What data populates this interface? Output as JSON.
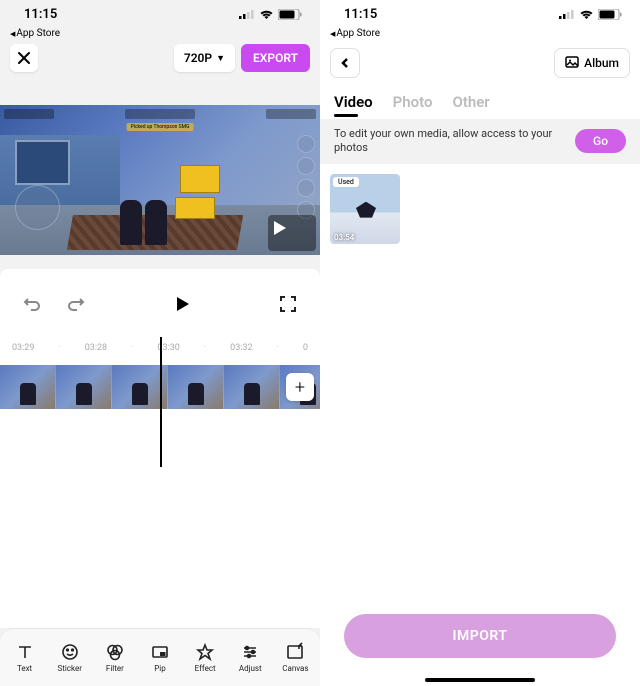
{
  "status": {
    "time": "11:15",
    "back_label": "App Store"
  },
  "left": {
    "resolution": "720P",
    "export": "EXPORT",
    "preview_tag": "Picked up Thompson SMG",
    "timecodes": [
      "03:29",
      "03:28",
      "03:30",
      "03:32"
    ],
    "toolbar": [
      {
        "key": "text",
        "label": "Text"
      },
      {
        "key": "sticker",
        "label": "Sticker"
      },
      {
        "key": "filter",
        "label": "Filter"
      },
      {
        "key": "pip",
        "label": "Pip"
      },
      {
        "key": "effect",
        "label": "Effect"
      },
      {
        "key": "adjust",
        "label": "Adjust"
      },
      {
        "key": "canvas",
        "label": "Canvas"
      }
    ]
  },
  "right": {
    "album": "Album",
    "tabs": {
      "video": "Video",
      "photo": "Photo",
      "other": "Other"
    },
    "permission": "To edit your own media, allow access to your photos",
    "go": "Go",
    "thumb": {
      "used": "Used",
      "duration": "03:54"
    },
    "import": "IMPORT"
  }
}
